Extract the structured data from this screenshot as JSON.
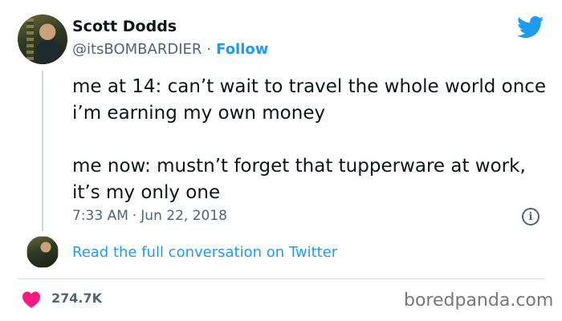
{
  "author": {
    "name": "Scott Dodds",
    "handle": "@itsBOMBARDIER",
    "separator": "·",
    "follow_label": "Follow"
  },
  "tweet": {
    "paragraphs": [
      "me at 14: can’t wait to travel the whole world once i’m earning my own money",
      "me now: mustn’t forget that tupperware at work, it’s my only one"
    ],
    "time": "7:33 AM",
    "separator": "·",
    "date": "Jun 22, 2018"
  },
  "conversation": {
    "read_full_label": "Read the full conversation on Twitter"
  },
  "stats": {
    "likes": "274.7K"
  },
  "watermark": "boredpanda.com",
  "icons": {
    "logo": "twitter-bird-icon",
    "info": "info-icon",
    "like": "heart-icon"
  },
  "colors": {
    "accent": "#1d9bf0",
    "text": "#0f1419",
    "secondary": "#536471",
    "like": "#f91880",
    "border": "#cfd9de"
  }
}
